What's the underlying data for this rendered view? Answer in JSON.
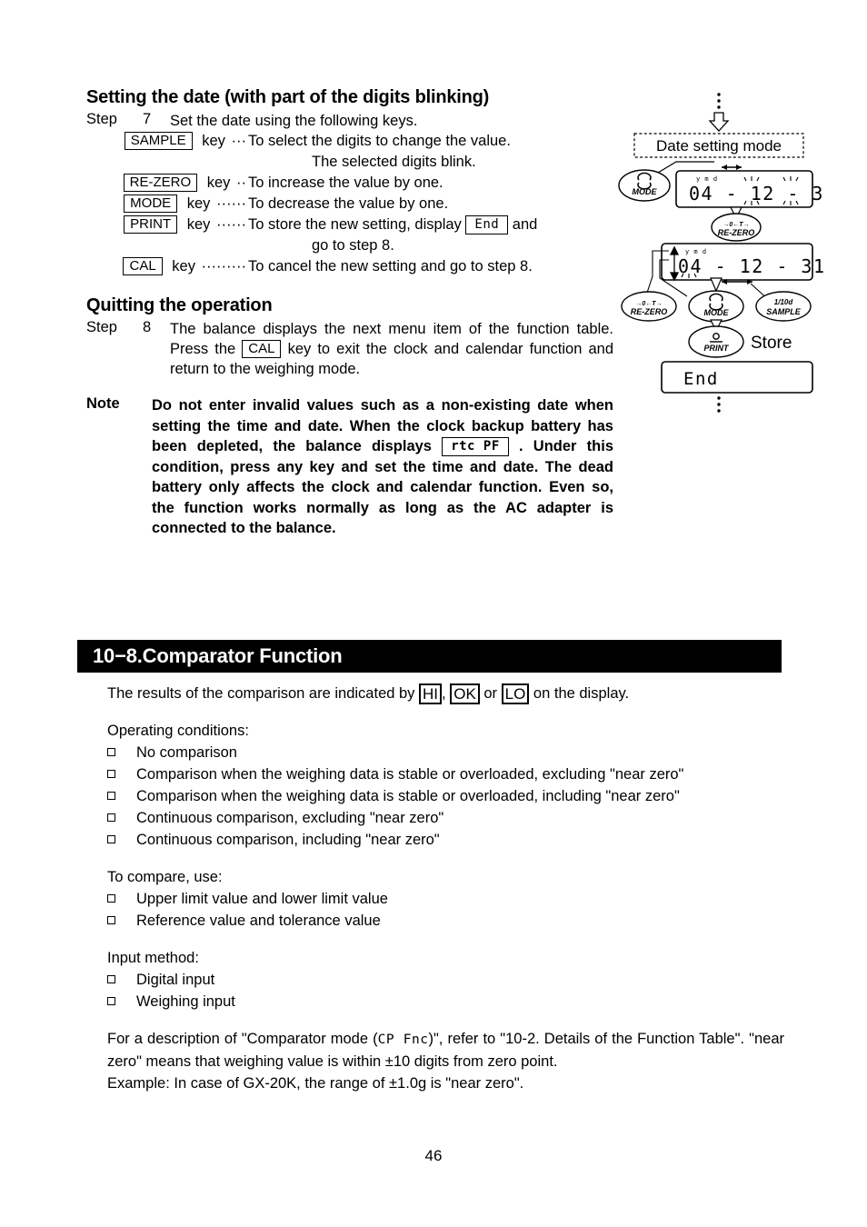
{
  "page": {
    "number": "46"
  },
  "date_setting": {
    "heading": "Setting the date (with part of the digits blinking)",
    "step_label": "Step",
    "step_number": "7",
    "step_intro": "Set the date using the following keys.",
    "keys": [
      {
        "key": "SAMPLE",
        "word": "key",
        "dots": "···",
        "desc": "To select the digits to change the value.",
        "cont": "The selected digits blink."
      },
      {
        "key": "RE-ZERO",
        "word": "key",
        "dots": "··",
        "desc": "To increase the value by one.",
        "cont": ""
      },
      {
        "key": "MODE",
        "word": "key",
        "dots": "······",
        "desc": "To decrease the value by one.",
        "cont": ""
      },
      {
        "key": "PRINT",
        "word": "key",
        "dots": "······",
        "desc_pre": "To store the new setting, display",
        "lcd": "End",
        "desc_post": "and",
        "cont": "go to step 8."
      },
      {
        "key": "CAL",
        "word": "key",
        "dots": "·········",
        "desc": "To cancel the new setting and go to step 8.",
        "cont": ""
      }
    ]
  },
  "quitting": {
    "heading": "Quitting the operation",
    "step_label": "Step",
    "step_number": "8",
    "text_pre": "The balance displays the next menu item of the function table. Press the",
    "key": "CAL",
    "text_post": "key to exit the clock and calendar function and return to the weighing mode."
  },
  "note": {
    "label": "Note",
    "line1": "Do not enter invalid values such as a non-existing date when setting the time and date.",
    "line2_pre": "When the clock backup battery has been depleted, the balance displays",
    "lcd": "rtc PF",
    "line2_post": ". Under this condition, press any key and set the time and date. The dead battery only affects the clock and calendar function. Even so, the function works normally as long as the AC adapter is connected to the balance."
  },
  "diagram": {
    "mode_box_label": "Date setting mode",
    "display_1": "04 - 12 - 31",
    "display_2": "04 - 12 - 31",
    "display_3": "End",
    "annunciator": "y m d",
    "keys": {
      "mode_top": "MODE",
      "rezero_mid": "RE-ZERO",
      "rezero_mid_sym": "→0←T→",
      "rezero_bot": "RE-ZERO",
      "rezero_bot_sym": "→0←T→",
      "mode_bot": "MODE",
      "sample_bot": "SAMPLE",
      "sample_bot_sym": "1/10d",
      "print": "PRINT"
    },
    "store_label": "Store"
  },
  "section": {
    "title": "10−8.Comparator Function"
  },
  "comparator": {
    "intro_pre": "The results of the comparison are indicated by",
    "tag_hi": "HI",
    "intro_mid1": ",",
    "tag_ok": "OK",
    "intro_mid2": "or",
    "tag_lo": "LO",
    "intro_post": "on the display.",
    "operating_heading": "Operating conditions:",
    "operating_items": [
      "No comparison",
      "Comparison when the weighing data is stable or overloaded, excluding \"near zero\"",
      "Comparison when the weighing data is stable or overloaded, including \"near zero\"",
      "Continuous comparison, excluding \"near zero\"",
      "Continuous comparison, including \"near zero\""
    ],
    "compare_heading": "To compare, use:",
    "compare_items": [
      "Upper limit value and lower limit value",
      "Reference value and tolerance value"
    ],
    "input_heading": "Input method:",
    "input_items": [
      "Digital input",
      "Weighing input"
    ],
    "closing_pre": "For a description of \"Comparator mode (",
    "closing_lcd": "CP Fnc",
    "closing_post": ")\", refer to \"10-2. Details of the Function Table\". \"near zero\" means that weighing value is within ±10 digits from zero point.",
    "example": "Example: In case of GX-20K, the range of ±1.0g is \"near zero\"."
  }
}
